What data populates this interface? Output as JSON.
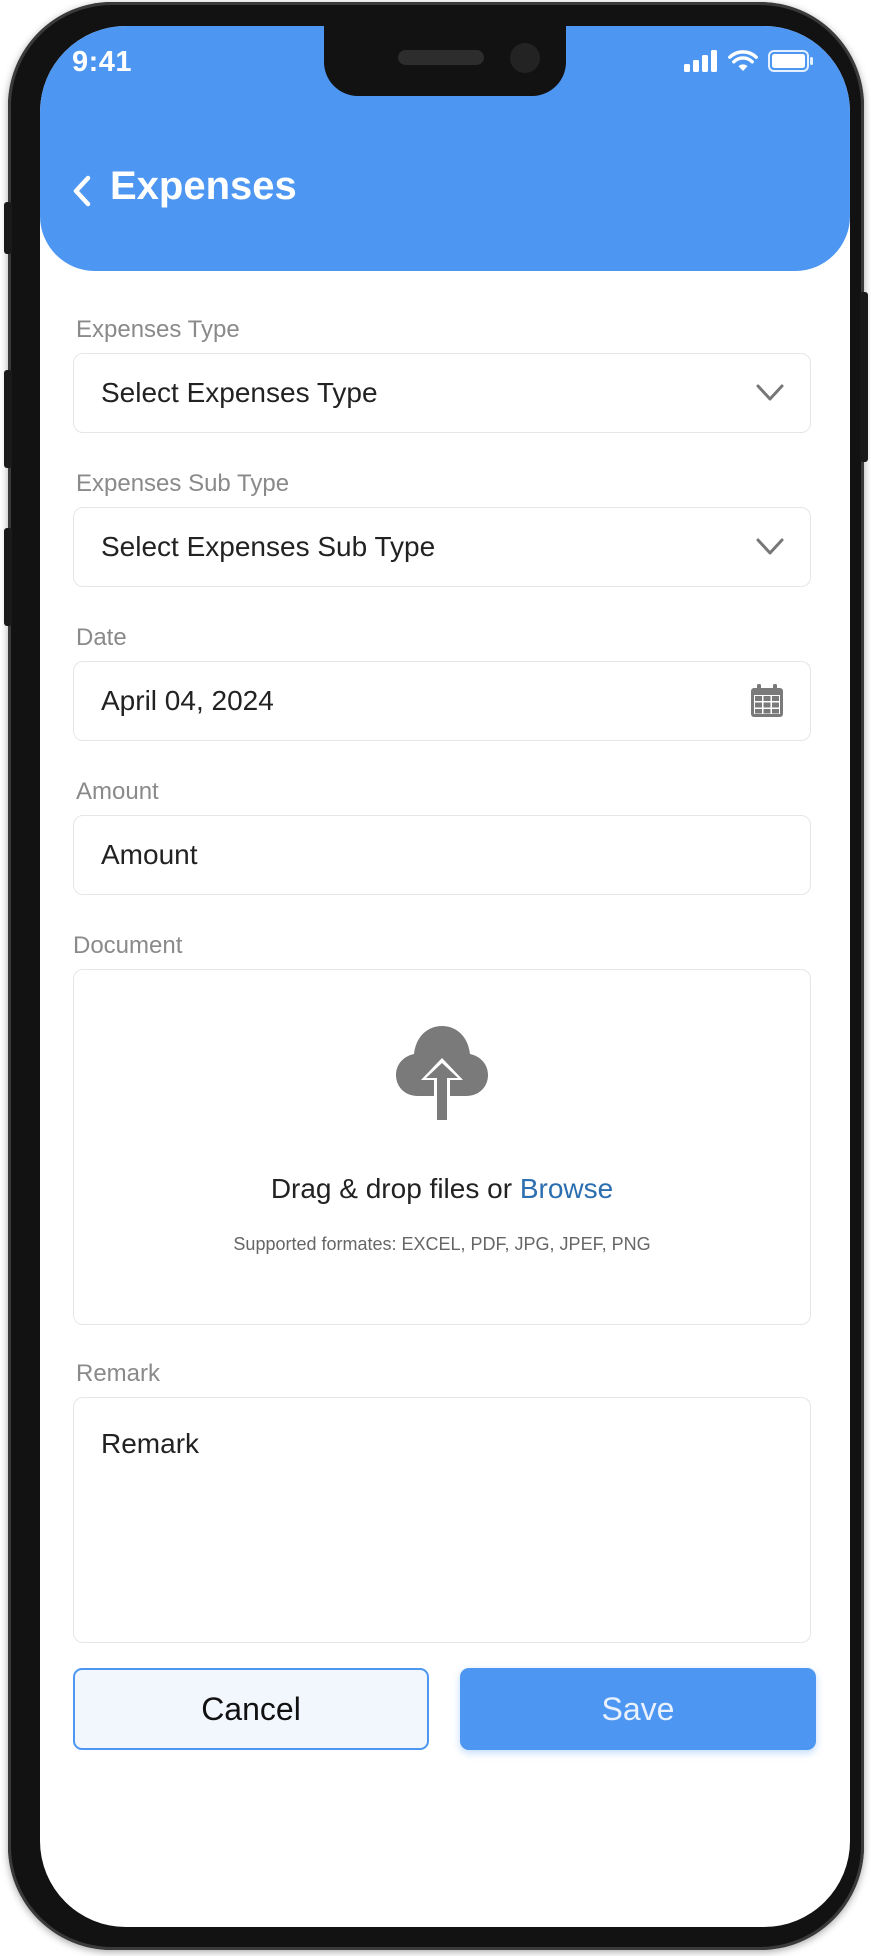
{
  "status_bar": {
    "time": "9:41"
  },
  "header": {
    "title": "Expenses"
  },
  "form": {
    "expense_type": {
      "label": "Expenses Type",
      "value": "Select Expenses Type"
    },
    "expense_sub_type": {
      "label": "Expenses Sub Type",
      "value": "Select Expenses Sub Type"
    },
    "date": {
      "label": "Date",
      "value": "April 04, 2024"
    },
    "amount": {
      "label": "Amount",
      "placeholder": "Amount"
    },
    "document": {
      "label": "Document",
      "drag_text": "Drag & drop files or ",
      "browse_text": "Browse",
      "formats_text": "Supported formates: EXCEL, PDF, JPG, JPEF, PNG"
    },
    "remark": {
      "label": "Remark",
      "placeholder": "Remark"
    }
  },
  "actions": {
    "cancel_label": "Cancel",
    "save_label": "Save"
  },
  "colors": {
    "primary": "#4d97f3",
    "link": "#2c6fb0",
    "cancel_bg": "#f1f7fd",
    "icon_gray": "#7a7a7a"
  },
  "icons": {
    "back": "chevron-left-icon",
    "dropdown": "chevron-down-icon",
    "calendar": "calendar-icon",
    "upload": "cloud-upload-icon",
    "signal": "signal-icon",
    "wifi": "wifi-icon",
    "battery": "battery-icon"
  }
}
